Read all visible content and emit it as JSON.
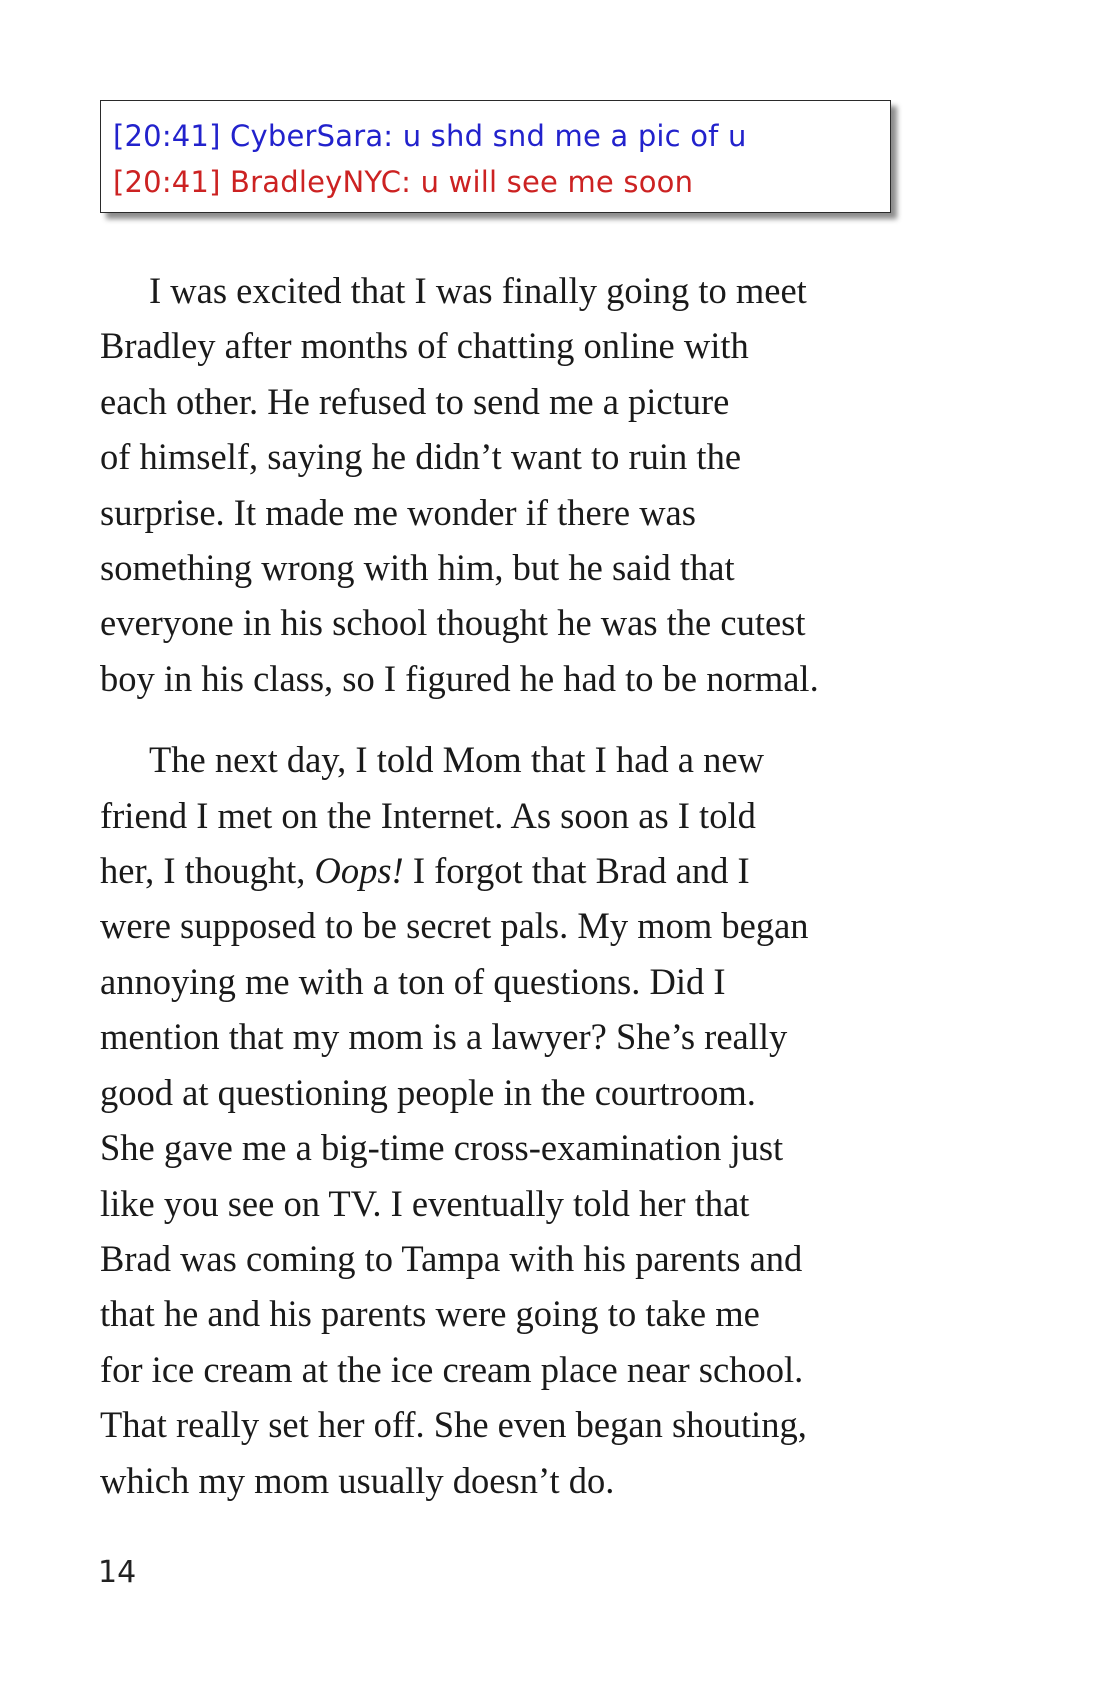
{
  "chat": [
    {
      "time": "[20:41]",
      "user": "CyberSara:",
      "message": "u shd snd me a pic of u",
      "color": "#2222cc"
    },
    {
      "time": "[20:41]",
      "user": "BradleyNYC:",
      "message": "u will see me soon",
      "color": "#cc2222"
    }
  ],
  "paragraph1": {
    "lines": [
      "I was excited that I was finally going to meet",
      "Bradley after months of chatting online with",
      "each other.  He refused to send me a picture",
      "of himself, saying he didn’t want to ruin the",
      "surprise. It made me wonder if there was",
      "something wrong with him, but he said that",
      "everyone in his school thought he was the cutest",
      "boy in his class, so I figured he had to be normal."
    ]
  },
  "paragraph2": {
    "line1": "The next day, I told Mom that I had a new",
    "line2": "friend I met on the Internet. As soon as I told",
    "line3_before": "her, I thought, ",
    "line3_italic": "Oops!",
    "line3_after": " I forgot that Brad and I",
    "lines_rest": [
      "were supposed to be secret pals. My mom began",
      "annoying me with a ton of questions. Did I",
      "mention that my mom is a lawyer? She’s really",
      "good at questioning people in the courtroom.",
      "She gave me a big-time cross-examination just",
      "like you see on TV. I eventually told her that",
      "Brad was coming to Tampa with his parents and",
      "that he and his parents were going to take me",
      "for ice cream at the ice cream place near school.",
      "That really set her off. She even began shouting,",
      "which my mom usually doesn’t do."
    ]
  },
  "page_number": "14"
}
